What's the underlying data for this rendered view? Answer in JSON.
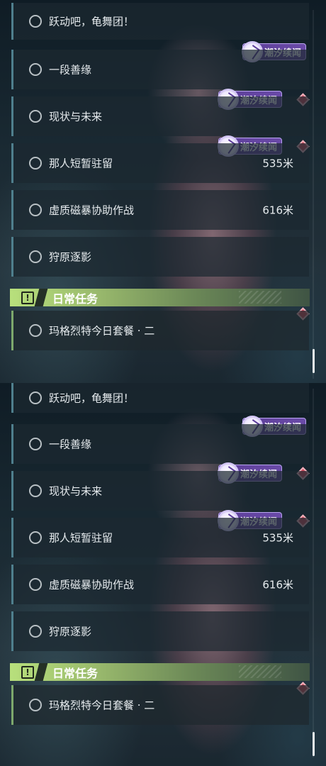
{
  "quests": [
    {
      "name": "跃动吧，龟舞团！",
      "distance": ""
    },
    {
      "name": "一段善缘",
      "distance": ""
    },
    {
      "name": "现状与未来",
      "distance": ""
    },
    {
      "name": "那人短暂驻留",
      "distance": "535米"
    },
    {
      "name": "虚质磁暴协助作战",
      "distance": "616米"
    },
    {
      "name": "狩原逐影",
      "distance": ""
    }
  ],
  "badges": {
    "label": "潮汐续闻",
    "icon": "tide-swirl-icon"
  },
  "daily": {
    "header_title": "日常任务",
    "header_icon": "!",
    "quest_name": "玛格烈特今日套餐 · 二"
  },
  "colors": {
    "story_accent": "#4f7f8d",
    "daily_accent": "#7da86c",
    "badge_purple": "#5c3f98",
    "marker_red": "#cc4a5c",
    "header_green": "#b8e07c"
  }
}
